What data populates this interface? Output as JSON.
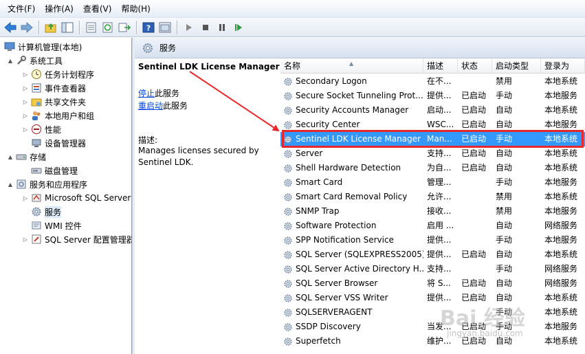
{
  "menu": [
    "文件(F)",
    "操作(A)",
    "查看(V)",
    "帮助(H)"
  ],
  "toolbar": {
    "icons": [
      "back-icon",
      "forward-icon",
      "up-folder-icon",
      "show-tree-icon",
      "properties-icon",
      "refresh-icon",
      "export-icon",
      "help-icon",
      "console-icon",
      "play-icon",
      "stop-icon",
      "pause-icon",
      "restart-icon"
    ]
  },
  "tree": [
    {
      "label": "计算机管理(本地)",
      "level": 0,
      "arrow": "",
      "icon": "computer-icon"
    },
    {
      "label": "系统工具",
      "level": 1,
      "arrow": "▲",
      "icon": "tools-icon"
    },
    {
      "label": "任务计划程序",
      "level": 2,
      "arrow": "▷",
      "icon": "clock-icon"
    },
    {
      "label": "事件查看器",
      "level": 2,
      "arrow": "▷",
      "icon": "event-viewer-icon"
    },
    {
      "label": "共享文件夹",
      "level": 2,
      "arrow": "▷",
      "icon": "shared-folder-icon"
    },
    {
      "label": "本地用户和组",
      "level": 2,
      "arrow": "▷",
      "icon": "users-icon"
    },
    {
      "label": "性能",
      "level": 2,
      "arrow": "▷",
      "icon": "performance-icon"
    },
    {
      "label": "设备管理器",
      "level": 2,
      "arrow": "",
      "icon": "device-manager-icon"
    },
    {
      "label": "存储",
      "level": 1,
      "arrow": "▲",
      "icon": "storage-icon"
    },
    {
      "label": "磁盘管理",
      "level": 2,
      "arrow": "",
      "icon": "disk-icon"
    },
    {
      "label": "服务和应用程序",
      "level": 1,
      "arrow": "▲",
      "icon": "services-apps-icon"
    },
    {
      "label": "Microsoft SQL Server",
      "level": 2,
      "arrow": "▷",
      "icon": "sql-icon"
    },
    {
      "label": "服务",
      "level": 2,
      "arrow": "",
      "icon": "gear-icon",
      "selected": true
    },
    {
      "label": "WMI 控件",
      "level": 2,
      "arrow": "",
      "icon": "wmi-icon"
    },
    {
      "label": "SQL Server 配置管理器",
      "level": 2,
      "arrow": "▷",
      "icon": "sql-config-icon"
    }
  ],
  "header": {
    "title": "服务"
  },
  "description": {
    "service_name": "Sentinel LDK License Manager",
    "stop_link": "停止",
    "stop_suffix": "此服务",
    "restart_link": "重启动",
    "restart_suffix": "此服务",
    "desc_label": "描述:",
    "desc_text": "Manages licenses secured by Sentinel LDK."
  },
  "columns": [
    "名称",
    "描述",
    "状态",
    "启动类型",
    "登录为"
  ],
  "services": [
    {
      "name": "Secondary Logon",
      "desc": "在不...",
      "status": "",
      "startup": "禁用",
      "logon": "本地系统"
    },
    {
      "name": "Secure Socket Tunneling Prot...",
      "desc": "提供...",
      "status": "已启动",
      "startup": "手动",
      "logon": "本地服务"
    },
    {
      "name": "Security Accounts Manager",
      "desc": "启动...",
      "status": "已启动",
      "startup": "自动",
      "logon": "本地系统"
    },
    {
      "name": "Security Center",
      "desc": "WSC...",
      "status": "已启动",
      "startup": "自动",
      "logon": "本地服务"
    },
    {
      "name": "Sentinel LDK License Manager",
      "desc": "Man...",
      "status": "已启动",
      "startup": "手动",
      "logon": "本地系统",
      "selected": true
    },
    {
      "name": "Server",
      "desc": "支持...",
      "status": "已启动",
      "startup": "自动",
      "logon": "本地系统"
    },
    {
      "name": "Shell Hardware Detection",
      "desc": "为自...",
      "status": "已启动",
      "startup": "自动",
      "logon": "本地系统"
    },
    {
      "name": "Smart Card",
      "desc": "管理...",
      "status": "",
      "startup": "手动",
      "logon": "本地服务"
    },
    {
      "name": "Smart Card Removal Policy",
      "desc": "允许...",
      "status": "",
      "startup": "禁用",
      "logon": "本地系统"
    },
    {
      "name": "SNMP Trap",
      "desc": "接收...",
      "status": "",
      "startup": "禁用",
      "logon": "本地服务"
    },
    {
      "name": "Software Protection",
      "desc": "启用 ...",
      "status": "",
      "startup": "自动",
      "logon": "网络服务"
    },
    {
      "name": "SPP Notification Service",
      "desc": "提供...",
      "status": "",
      "startup": "手动",
      "logon": "本地服务"
    },
    {
      "name": "SQL Server (SQLEXPRESS2005)",
      "desc": "提供...",
      "status": "已启动",
      "startup": "自动",
      "logon": "本地系统"
    },
    {
      "name": "SQL Server Active Directory H...",
      "desc": "支持...",
      "status": "",
      "startup": "手动",
      "logon": "网络服务"
    },
    {
      "name": "SQL Server Browser",
      "desc": "将 S...",
      "status": "已启动",
      "startup": "自动",
      "logon": "网络服务"
    },
    {
      "name": "SQL Server VSS Writer",
      "desc": "提供...",
      "status": "已启动",
      "startup": "自动",
      "logon": "本地系统"
    },
    {
      "name": "SQLSERVERAGENT",
      "desc": "",
      "status": "",
      "startup": "手动",
      "logon": "本地系统"
    },
    {
      "name": "SSDP Discovery",
      "desc": "当发...",
      "status": "已启动",
      "startup": "手动",
      "logon": "本地服务"
    },
    {
      "name": "Superfetch",
      "desc": "维护...",
      "status": "已启动",
      "startup": "自动",
      "logon": "本地系统"
    }
  ],
  "watermark": {
    "text": "Bai 经验",
    "sub": "jingyan.baidu.com"
  },
  "colors": {
    "selection": "#3399ff",
    "annotation": "#e5282c",
    "link": "#0046d5"
  }
}
